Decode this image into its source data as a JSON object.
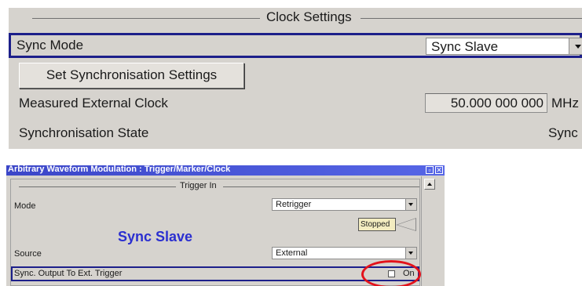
{
  "clock_settings": {
    "group_title": "Clock Settings",
    "sync_mode_label": "Sync Mode",
    "sync_mode_value": "Sync Slave",
    "set_sync_button": "Set Synchronisation Settings",
    "measured_clock_label": "Measured External Clock",
    "measured_clock_value": "50.000 000 000",
    "measured_clock_unit": "MHz",
    "sync_state_label": "Synchronisation State",
    "sync_state_value": "Sync"
  },
  "arb_window": {
    "title": "Arbitrary Waveform Modulation : Trigger/Marker/Clock",
    "group_title": "Trigger In",
    "mode_label": "Mode",
    "mode_value": "Retrigger",
    "sync_slave_text": "Sync Slave",
    "status_badge": "Stopped",
    "source_label": "Source",
    "source_value": "External",
    "sync_output_label": "Sync. Output To Ext. Trigger",
    "sync_output_checkbox_label": "On"
  },
  "colors": {
    "panel_bg": "#d6d3ce",
    "focus_border": "#1c1f8a",
    "highlight_text": "#2b2fd0",
    "title_bar": "#3b46c8",
    "annotation_ring": "#e3121b"
  }
}
